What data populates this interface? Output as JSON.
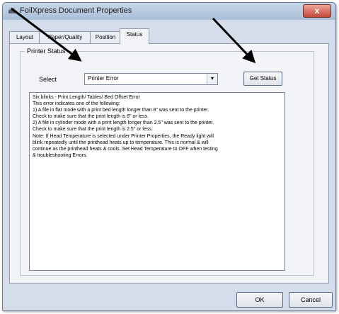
{
  "window": {
    "title": "FoilXpress Document Properties",
    "close_glyph": "x"
  },
  "tabs": [
    {
      "label": "Layout"
    },
    {
      "label": "Paper/Quality"
    },
    {
      "label": "Position"
    },
    {
      "label": "Status",
      "active": true
    }
  ],
  "printer_status": {
    "legend": "Printer Status",
    "select_label": "Select",
    "select_value": "Printer Error",
    "get_status_label": "Get Status",
    "message_lines": [
      "Six blinks - Print Length/ Tables/ Bed Offset Error",
      "This error indicates one of the following:",
      "1) A file in flat mode with a print bed length longer than 8\" was sent to the printer.",
      "Check to make sure that the print length is 8\" or less.",
      "2) A file in cylinder mode with a print length longer than 2.5\" was sent to the printer.",
      "Check to make sure that the print length is 2.5\" or less.",
      "Note: If Head Temperature is selected under Printer Properties, the Ready light will",
      "blink repeatedly until the printhead heats up to temperature.  This is normal & will",
      "continue as the printhead heats & cools.  Set Head Temperature to OFF when testing",
      "& troubleshooting Errors."
    ]
  },
  "buttons": {
    "ok": "OK",
    "cancel": "Cancel"
  },
  "annotations": {
    "arrow_color": "#000000",
    "arrows": [
      "arrow-to-select-dropdown",
      "arrow-to-get-status-button"
    ]
  }
}
